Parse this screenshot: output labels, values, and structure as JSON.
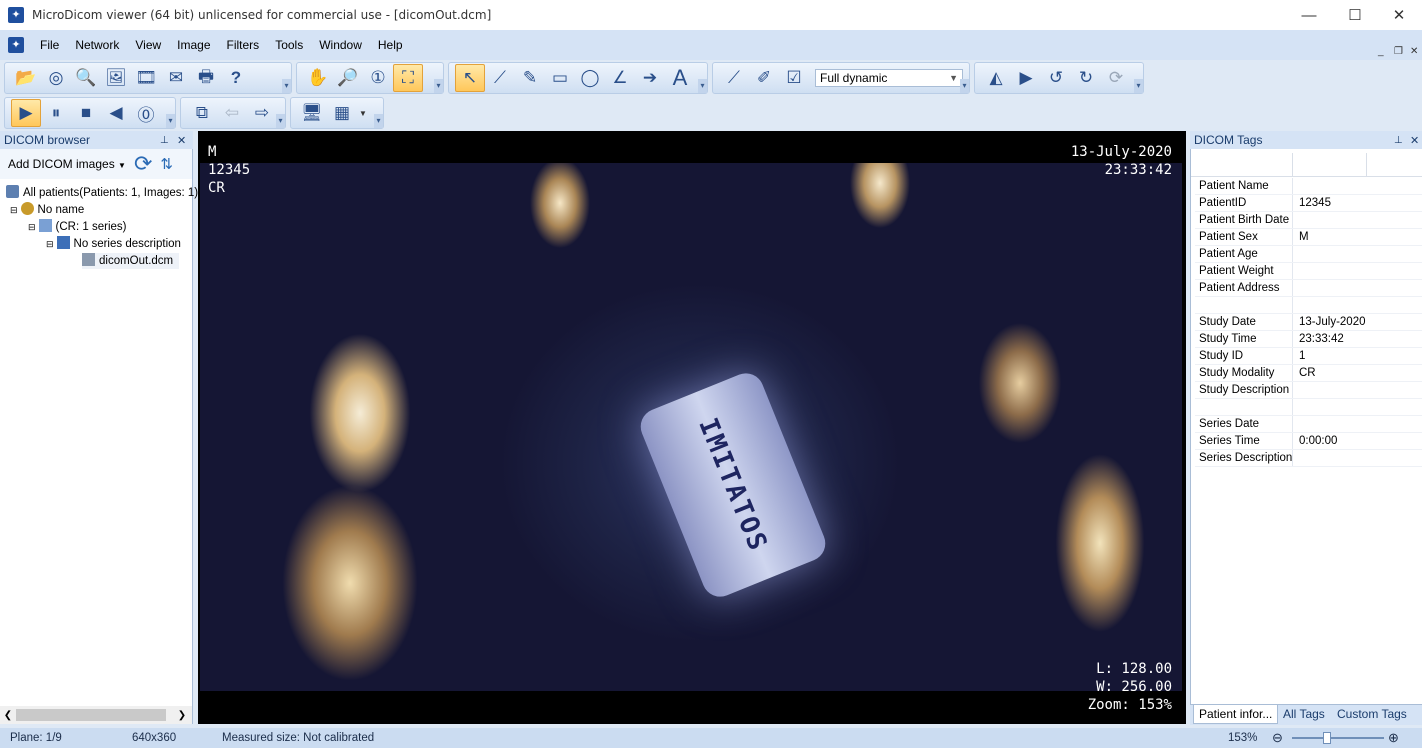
{
  "window": {
    "title": "MicroDicom viewer (64 bit) unlicensed for commercial use - [dicomOut.dcm]",
    "minimize": "—",
    "maximize": "☐",
    "close": "✕"
  },
  "menu": [
    "File",
    "Network",
    "View",
    "Image",
    "Filters",
    "Tools",
    "Window",
    "Help"
  ],
  "mdi": {
    "minimize": "_",
    "restore": "❐",
    "close": "✕"
  },
  "toolbar": {
    "window_level_preset": "Full dynamic"
  },
  "left_panel": {
    "title": "DICOM browser",
    "add_button": "Add DICOM images",
    "tree": [
      {
        "label": "All patients(Patients: 1, Images: 1)"
      },
      {
        "label": "No name"
      },
      {
        "label": "(CR: 1 series)"
      },
      {
        "label": "No series description"
      },
      {
        "label": "dicomOut.dcm"
      }
    ]
  },
  "viewer": {
    "top_left": [
      "M",
      "12345",
      "CR"
    ],
    "top_right": [
      "13-July-2020",
      "23:33:42"
    ],
    "bottom_right": [
      "L: 128.00",
      "W: 256.00",
      "Zoom: 153%"
    ],
    "image_text": "IMITATOS"
  },
  "right_panel": {
    "title": "DICOM Tags",
    "tags": [
      {
        "key": "Patient Name",
        "value": ""
      },
      {
        "key": "PatientID",
        "value": "12345"
      },
      {
        "key": "Patient Birth Date",
        "value": ""
      },
      {
        "key": "Patient Sex",
        "value": "M"
      },
      {
        "key": "Patient Age",
        "value": ""
      },
      {
        "key": "Patient Weight",
        "value": ""
      },
      {
        "key": "Patient Address",
        "value": ""
      },
      {
        "key": "",
        "value": ""
      },
      {
        "key": "Study Date",
        "value": "13-July-2020"
      },
      {
        "key": "Study Time",
        "value": "23:33:42"
      },
      {
        "key": "Study ID",
        "value": "1"
      },
      {
        "key": "Study Modality",
        "value": "CR"
      },
      {
        "key": "Study Description",
        "value": ""
      },
      {
        "key": "",
        "value": ""
      },
      {
        "key": "Series Date",
        "value": ""
      },
      {
        "key": "Series Time",
        "value": "0:00:00"
      },
      {
        "key": "Series Description",
        "value": ""
      }
    ],
    "tabs": [
      "Patient infor...",
      "All Tags",
      "Custom Tags"
    ]
  },
  "status": {
    "plane": "Plane: 1/9",
    "size": "640x360",
    "measured": "Measured size: Not calibrated",
    "zoom": "153%"
  }
}
